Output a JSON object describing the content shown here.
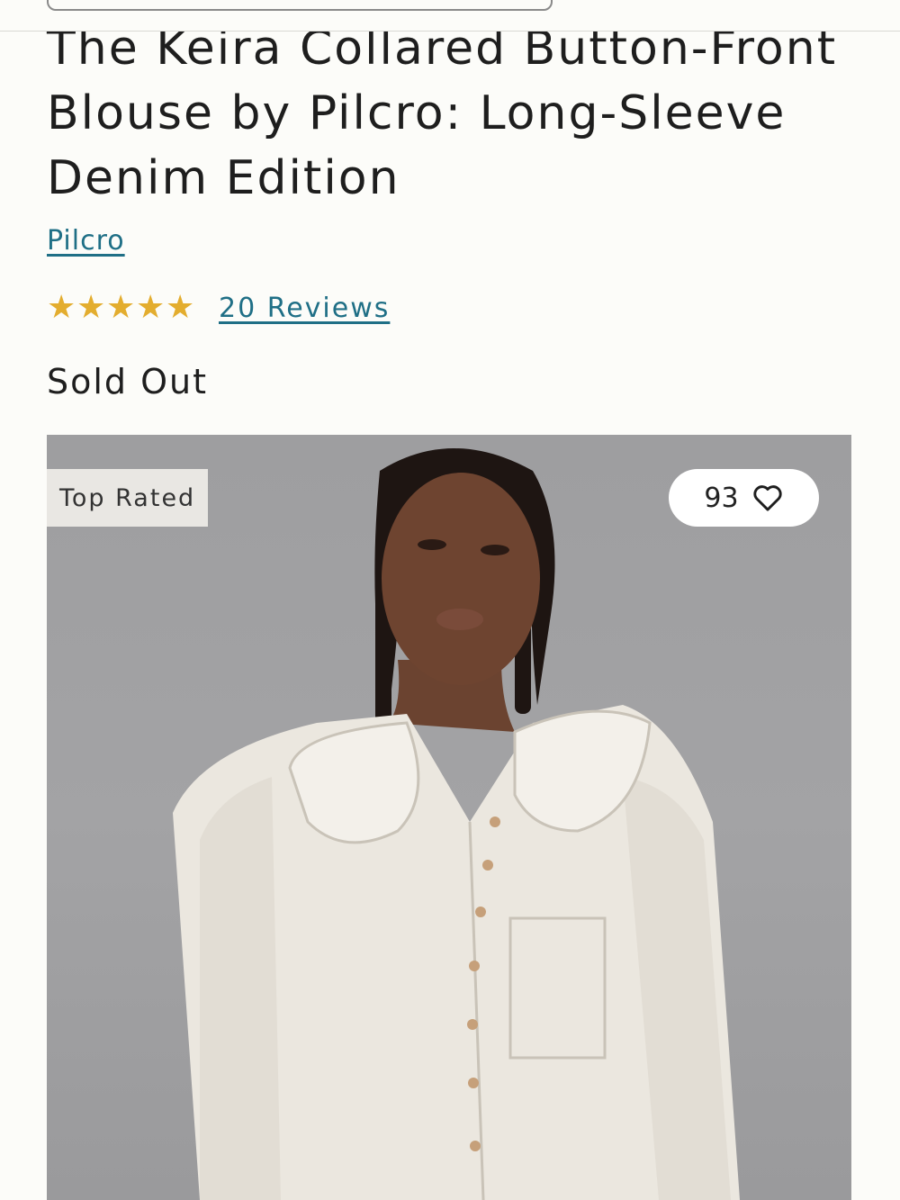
{
  "product": {
    "title": "The Keira Collared Button-Front Blouse by Pilcro: Long-Sleeve Denim Edition",
    "brand": "Pilcro",
    "rating_stars": 5,
    "reviews_label": "20 Reviews",
    "stock_status": "Sold Out"
  },
  "image": {
    "badge": "Top Rated",
    "favorites_count": "93",
    "favorite_icon": "heart-outline-icon"
  },
  "colors": {
    "link": "#1f6f86",
    "star": "#e3ad2f",
    "background": "#fcfcf9"
  }
}
